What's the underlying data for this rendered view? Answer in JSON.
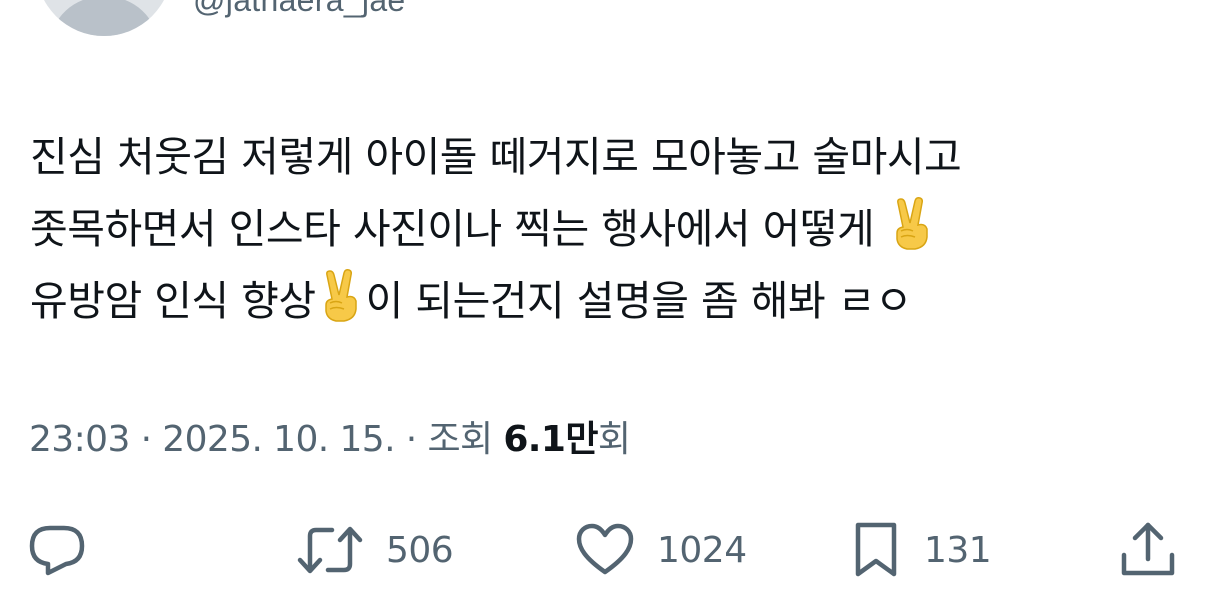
{
  "author": {
    "handle": "@jathaera_jae"
  },
  "tweet": {
    "lines": [
      {
        "before": "진심 처웃김 저렇게 아이돌 떼거지로 모아놓고 술마시고",
        "emoji": "",
        "after": ""
      },
      {
        "before": "좃목하면서 인스타 사진이나 찍는 행사에서 어떻게 ",
        "emoji": "victory-hand-emoji",
        "after": ""
      },
      {
        "before": "유방암 인식 향상",
        "emoji": "victory-hand-emoji",
        "after": "이 되는건지 설명을 좀 해봐 ㄹㅇ"
      }
    ]
  },
  "meta": {
    "time": "23:03",
    "separator": " · ",
    "date": "2025. 10. 15.",
    "views_label": "조회 ",
    "views_count": "6.1만",
    "views_suffix": "회"
  },
  "actions": {
    "reply": {
      "icon": "reply-icon",
      "count": ""
    },
    "retweet": {
      "icon": "retweet-icon",
      "count": "506"
    },
    "like": {
      "icon": "heart-icon",
      "count": "1024"
    },
    "bookmark": {
      "icon": "bookmark-icon",
      "count": "131"
    },
    "share": {
      "icon": "share-icon",
      "count": ""
    }
  },
  "colors": {
    "text": "#0f1419",
    "secondary": "#536471",
    "avatar_bg": "#dfe3e7",
    "emoji": "#f7c948"
  }
}
